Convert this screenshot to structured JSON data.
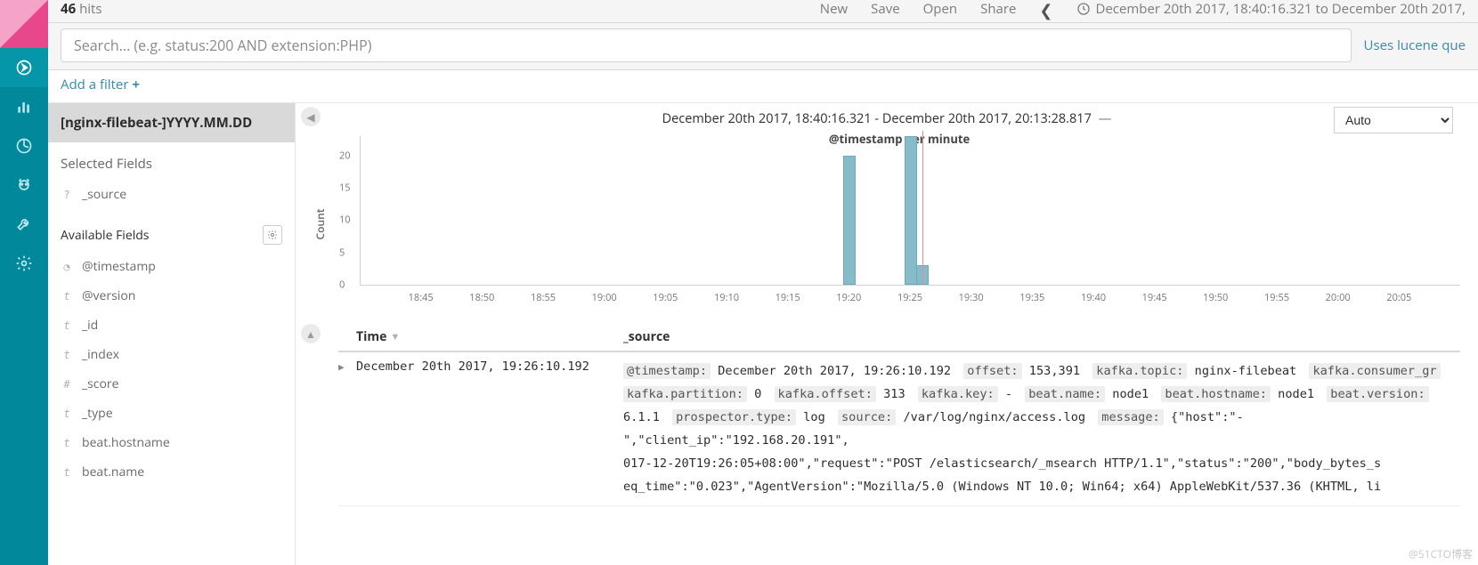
{
  "topbar": {
    "hits_count": "46",
    "hits_suffix": "hits",
    "actions": [
      "New",
      "Save",
      "Open",
      "Share"
    ],
    "time_range": "December 20th 2017, 18:40:16.321 to December 20th 2017,"
  },
  "search": {
    "placeholder": "Search... (e.g. status:200 AND extension:PHP)",
    "lucene_link": "Uses lucene que"
  },
  "filter": {
    "add_filter_label": "Add a filter"
  },
  "fields": {
    "index_pattern": "[nginx-filebeat-]YYYY.MM.DD",
    "selected_title": "Selected Fields",
    "available_title": "Available Fields",
    "selected": [
      {
        "type": "q",
        "name": "_source"
      }
    ],
    "available": [
      {
        "type": "clock",
        "name": "@timestamp"
      },
      {
        "type": "text",
        "name": "@version"
      },
      {
        "type": "text",
        "name": "_id"
      },
      {
        "type": "text",
        "name": "_index"
      },
      {
        "type": "hash",
        "name": "_score"
      },
      {
        "type": "text",
        "name": "_type"
      },
      {
        "type": "text",
        "name": "beat.hostname"
      },
      {
        "type": "text",
        "name": "beat.name"
      }
    ]
  },
  "chart_data": {
    "type": "bar",
    "title": "December 20th 2017, 18:40:16.321 - December 20th 2017, 20:13:28.817",
    "xlabel": "@timestamp per minute",
    "ylabel": "Count",
    "ylim": [
      0,
      23
    ],
    "yticks": [
      0,
      5,
      10,
      15,
      20
    ],
    "categories": [
      "18:45",
      "18:50",
      "18:55",
      "19:00",
      "19:05",
      "19:10",
      "19:15",
      "19:20",
      "19:25",
      "19:30",
      "19:35",
      "19:40",
      "19:45",
      "19:50",
      "19:55",
      "20:00",
      "20:05"
    ],
    "bars": [
      {
        "x": "19:20",
        "value": 20
      },
      {
        "x": "19:25",
        "value": 23
      },
      {
        "x": "19:26",
        "value": 3
      }
    ],
    "cursor_at": "19:26",
    "interval_selected": "Auto"
  },
  "doc_table": {
    "columns": {
      "time": "Time",
      "source": "_source"
    },
    "rows": [
      {
        "time": "December 20th 2017, 19:26:10.192",
        "kv": [
          {
            "k": "@timestamp:",
            "v": "December 20th 2017, 19:26:10.192"
          },
          {
            "k": "offset:",
            "v": "153,391"
          },
          {
            "k": "kafka.topic:",
            "v": "nginx-filebeat"
          },
          {
            "k": "kafka.consumer_gr",
            "v": ""
          },
          {
            "k": "kafka.partition:",
            "v": "0"
          },
          {
            "k": "kafka.offset:",
            "v": "313"
          },
          {
            "k": "kafka.key:",
            "v": "-"
          },
          {
            "k": "beat.name:",
            "v": "node1"
          },
          {
            "k": "beat.hostname:",
            "v": "node1"
          },
          {
            "k": "beat.version:",
            "v": "6.1.1"
          },
          {
            "k": "prospector.type:",
            "v": "log"
          },
          {
            "k": "source:",
            "v": "/var/log/nginx/access.log"
          },
          {
            "k": "message:",
            "v": "{\"host\":\"-\",\"client_ip\":\"192.168.20.191\","
          }
        ],
        "overflow_lines": [
          "017-12-20T19:26:05+08:00\",\"request\":\"POST /elasticsearch/_msearch HTTP/1.1\",\"status\":\"200\",\"body_bytes_s",
          "eq_time\":\"0.023\",\"AgentVersion\":\"Mozilla/5.0 (Windows NT 10.0; Win64; x64) AppleWebKit/537.36 (KHTML, li"
        ]
      }
    ]
  },
  "watermark": "@51CTO博客"
}
